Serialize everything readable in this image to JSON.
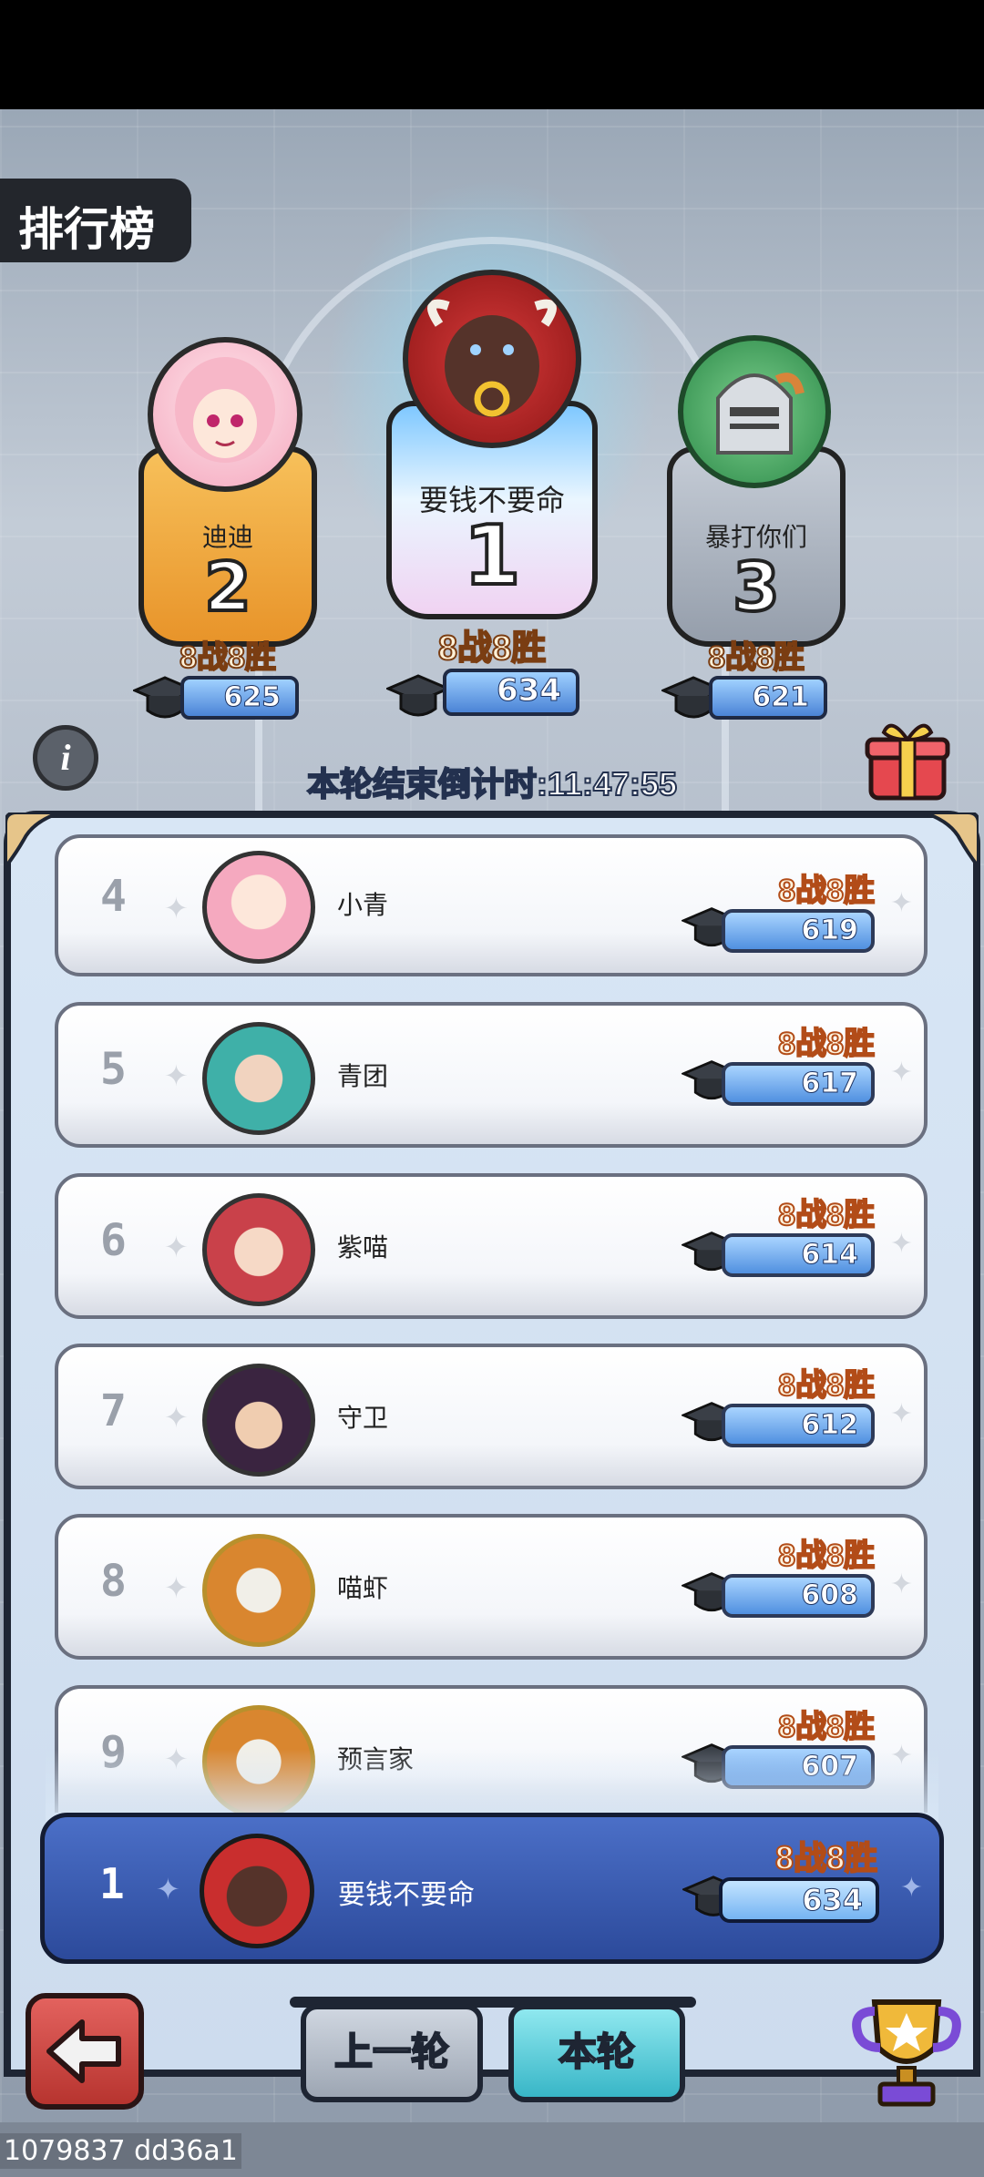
{
  "title": "排行榜",
  "podium": [
    {
      "rank": "2",
      "name": "迪迪",
      "record": "8战8胜",
      "score": "625",
      "avatar_icon": "pink-hair-girl-avatar"
    },
    {
      "rank": "1",
      "name": "要钱不要命",
      "record": "8战8胜",
      "score": "634",
      "avatar_icon": "red-bull-avatar"
    },
    {
      "rank": "3",
      "name": "暴打你们",
      "record": "8战8胜",
      "score": "621",
      "avatar_icon": "knight-helmet-avatar"
    }
  ],
  "countdown": "本轮结束倒计时:11:47:55",
  "list": [
    {
      "rank": "4",
      "name": "小青",
      "record": "8战8胜",
      "score": "619",
      "avatar_icon": "pink-hair-girl-avatar"
    },
    {
      "rank": "5",
      "name": "青团",
      "record": "8战8胜",
      "score": "617",
      "avatar_icon": "teal-hair-woman-avatar"
    },
    {
      "rank": "6",
      "name": "紫喵",
      "record": "8战8胜",
      "score": "614",
      "avatar_icon": "red-hair-elf-avatar"
    },
    {
      "rank": "7",
      "name": "守卫",
      "record": "8战8胜",
      "score": "612",
      "avatar_icon": "dark-hair-guard-avatar"
    },
    {
      "rank": "8",
      "name": "喵虾",
      "record": "8战8胜",
      "score": "608",
      "avatar_icon": "tiger-avatar"
    },
    {
      "rank": "9",
      "name": "预言家",
      "record": "8战8胜",
      "score": "607",
      "avatar_icon": "tiger-avatar"
    }
  ],
  "self": {
    "rank": "1",
    "name": "要钱不要命",
    "record": "8战8胜",
    "score": "634",
    "avatar_icon": "red-bull-avatar"
  },
  "tabs": {
    "prev": "上一轮",
    "current": "本轮"
  },
  "version": "1079837 dd36a1",
  "colors": {
    "gold_card": "#f2a73c",
    "silver_card": "#aeb6c2",
    "first_card": "#dff1ff",
    "self_row": "#2f4f9f",
    "score_pill": "#5090e0"
  }
}
